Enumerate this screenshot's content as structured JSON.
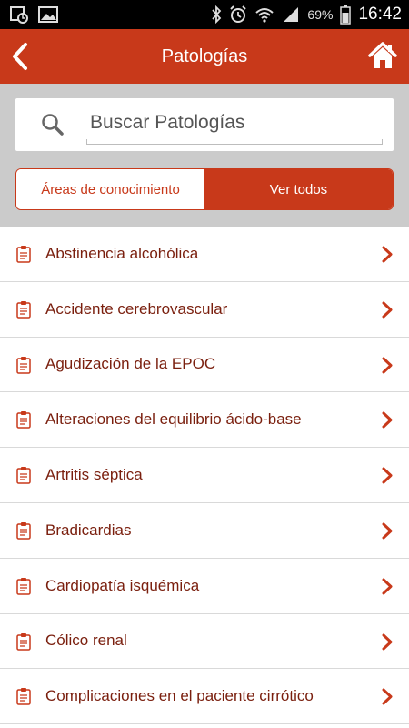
{
  "colors": {
    "accent": "#c8391a",
    "item_text": "#7a1f0e",
    "search_bg": "#cbcbcb"
  },
  "status_bar": {
    "left_icons": [
      "gallery-notification-icon",
      "image-notification-icon"
    ],
    "right_icons": [
      "bluetooth-icon",
      "alarm-icon",
      "wifi-icon",
      "signal-icon",
      "battery-icon"
    ],
    "battery": "69%",
    "time": "16:42"
  },
  "appbar": {
    "title": "Patologías",
    "back_icon": "chevron-left-icon",
    "home_icon": "home-icon"
  },
  "search": {
    "placeholder": "Buscar Patologías",
    "value": ""
  },
  "segmented": {
    "left_label": "Áreas de conocimiento",
    "right_label": "Ver todos",
    "selected": "Ver todos"
  },
  "items": [
    {
      "label": "Abstinencia alcohólica"
    },
    {
      "label": "Accidente cerebrovascular"
    },
    {
      "label": "Agudización de la EPOC"
    },
    {
      "label": "Alteraciones del equilibrio ácido-base"
    },
    {
      "label": "Artritis séptica"
    },
    {
      "label": "Bradicardias"
    },
    {
      "label": "Cardiopatía isquémica"
    },
    {
      "label": "Cólico renal"
    },
    {
      "label": "Complicaciones en el paciente cirrótico"
    }
  ]
}
